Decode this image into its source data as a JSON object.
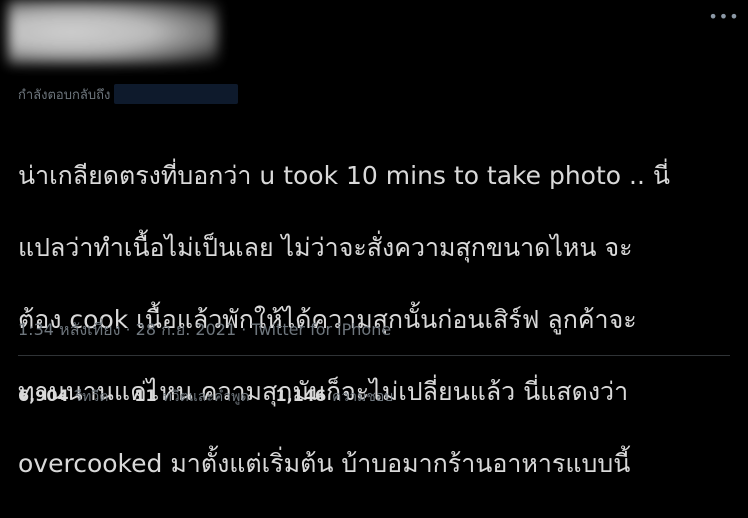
{
  "header": {
    "more_icon": "ellipsis-icon"
  },
  "reply": {
    "prefix": "กำลังตอบกลับถึง"
  },
  "tweet": {
    "text_lines": [
      "น่าเกลียดตรงที่บอกว่า u took 10 mins to take photo .. นี่",
      "แปลว่าทำเนื้อไม่เป็นเลย ไม่ว่าจะสั่งความสุกขนาดไหน จะ",
      "ต้อง cook เนื้อแล้วพักให้ได้ความสุกนั้นก่อนเสิร์ฟ ลูกค้าจะ",
      "ทานนานแค่ไหน ความสุกมันก็จะไม่เปลี่ยนแล้ว นี่แสดงว่า",
      "overcooked มาตั้งแต่เริ่มต้น บ้าบอมากร้านอาหารแบบนี้"
    ],
    "meta": "1:34 หลังเที่ยง · 28 ก.ย. 2021 · Twitter for iPhone"
  },
  "stats": {
    "retweets": {
      "count": "6,904",
      "label": "รีทวีต"
    },
    "quotes": {
      "count": "11",
      "label": "ทวีตและคำพูด"
    },
    "likes": {
      "count": "1,146",
      "label": "ความชอบ"
    }
  },
  "colors": {
    "background": "#000000",
    "text": "#d9d9d9",
    "secondary": "#6e767d",
    "divider": "#2f3336"
  }
}
